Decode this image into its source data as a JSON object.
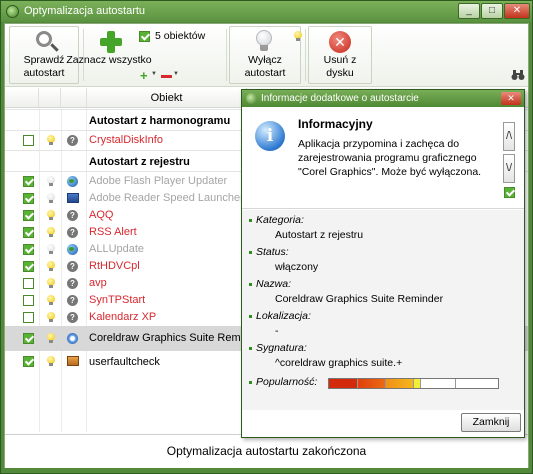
{
  "window": {
    "title": "Optymalizacja autostartu"
  },
  "toolbar": {
    "check_label": "Sprawdź autostart",
    "select_all_label": "Zaznacz wszystko",
    "count_label": "5 obiektów",
    "disable_label": "Wyłącz autostart",
    "remove_label": "Usuń z dysku"
  },
  "list": {
    "header_object": "Obiekt",
    "groups": {
      "schedule": "Autostart z harmonogramu",
      "registry": "Autostart z rejestru"
    },
    "rows": [
      {
        "name": "CrystalDiskInfo"
      },
      {
        "name": "Adobe Flash Player Updater"
      },
      {
        "name": "Adobe Reader Speed Launcher"
      },
      {
        "name": "AQQ"
      },
      {
        "name": "RSS Alert"
      },
      {
        "name": "ALLUpdate"
      },
      {
        "name": "RtHDVCpl"
      },
      {
        "name": "avp"
      },
      {
        "name": "SynTPStart"
      },
      {
        "name": "Kalendarz XP"
      },
      {
        "name": "Coreldraw Graphics Suite Reminder"
      },
      {
        "name": "userfaultcheck"
      }
    ]
  },
  "status": {
    "text": "Optymalizacja autostartu zakończona"
  },
  "popup": {
    "title": "Informacje dodatkowe o autostarcie",
    "info_title": "Informacyjny",
    "info_desc": "Aplikacja przypomina i zachęca do zarejestrowania programu graficznego \"Corel Graphics\". Może być wyłączona.",
    "scroll_up": "/\\",
    "scroll_down": "\\/",
    "category_label": "Kategoria:",
    "category_value": "Autostart z rejestru",
    "status_label": "Status:",
    "status_value": "włączony",
    "name_label": "Nazwa:",
    "name_value": "Coreldraw Graphics Suite Reminder",
    "location_label": "Lokalizacja:",
    "location_value": "-",
    "signature_label": "Sygnatura:",
    "signature_value": "^coreldraw graphics suite.+",
    "popularity_label": "Popularność:",
    "popularity_level": 0.5,
    "close_button": "Zamknij"
  },
  "colors": {
    "accent": "#58b334",
    "error_text": "#d8282f",
    "disabled_text": "#a5a5a5",
    "popularity": [
      "#d42a0c",
      "#ec6a12",
      "#f4b61c",
      "#f1ef3a"
    ]
  }
}
